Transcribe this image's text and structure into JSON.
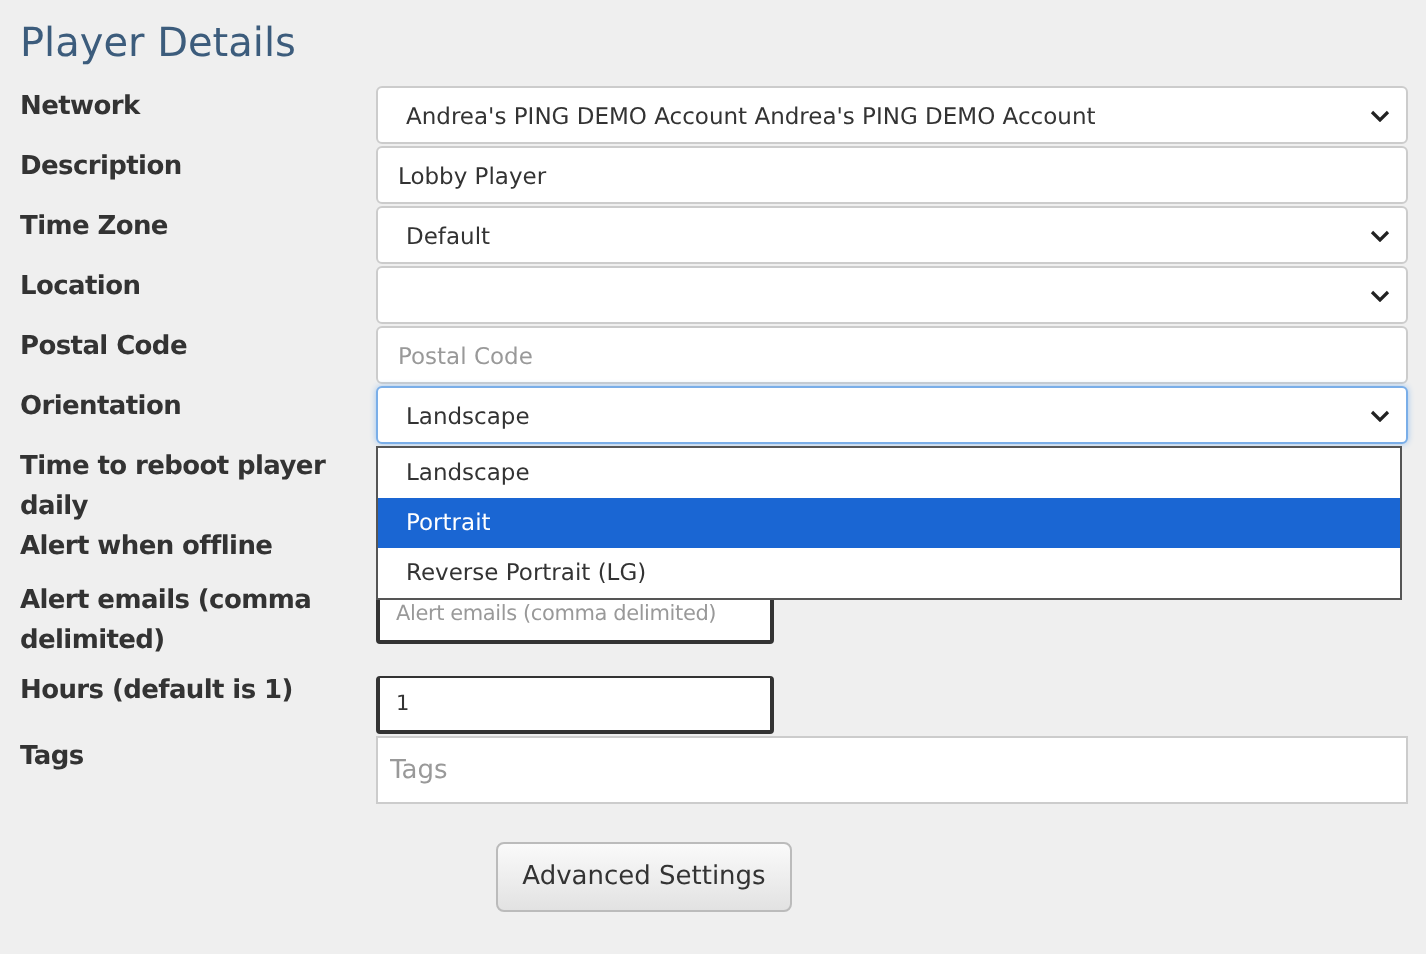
{
  "title": "Player Details",
  "fields": [
    {
      "label": "Network",
      "kind": "select",
      "value": "Andrea's PING DEMO Account Andrea's PING DEMO Account",
      "focused": false
    },
    {
      "label": "Description",
      "kind": "text",
      "value": "Lobby Player",
      "focused": false
    },
    {
      "label": "Time Zone",
      "kind": "select",
      "value": "Default",
      "focused": false
    },
    {
      "label": "Location",
      "kind": "select",
      "focused": false
    },
    {
      "label": "Postal Code",
      "kind": "text",
      "placeholder": "Postal Code",
      "focused": false
    },
    {
      "label": "Orientation",
      "kind": "select",
      "value": "Landscape",
      "focused": true
    },
    {
      "label": "Time to reboot player daily",
      "kind": "covered"
    },
    {
      "label": "Alert when offline",
      "kind": "covered"
    },
    {
      "label": "Alert emails (comma delimited)",
      "kind": "short",
      "placeholder": "Alert emails (comma delimited)",
      "focused": false
    },
    {
      "label": "Hours (default is 1)",
      "kind": "short",
      "value": "1",
      "focused": false
    },
    {
      "label": "Tags",
      "kind": "text",
      "placeholder": "Tags",
      "focused": false
    }
  ],
  "dropdown": {
    "options": [
      {
        "label": "Landscape",
        "selected": false
      },
      {
        "label": "Portrait",
        "selected": true
      },
      {
        "label": "Reverse Portrait (LG)",
        "selected": false
      }
    ]
  },
  "buttons": [
    "Advanced Settings"
  ]
}
